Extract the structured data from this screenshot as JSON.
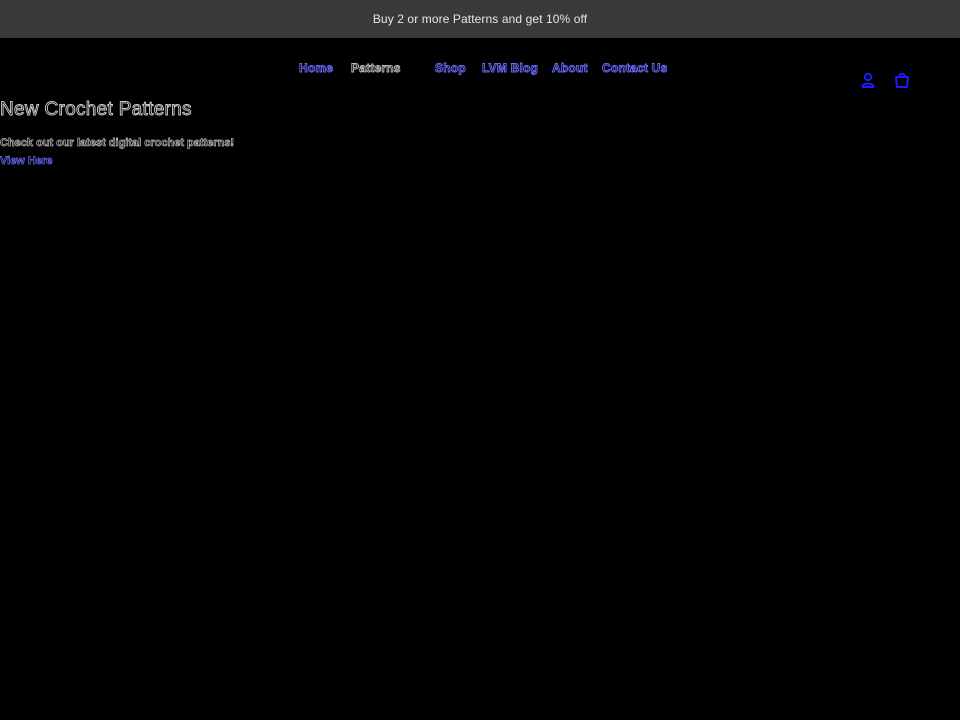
{
  "announcement": {
    "text": "Buy 2 or more Patterns and get 10% off"
  },
  "nav": {
    "items": [
      {
        "label": "Home"
      },
      {
        "label": "Patterns"
      },
      {
        "label": "Shop"
      },
      {
        "label": "LVM Blog"
      },
      {
        "label": "About"
      },
      {
        "label": "Contact Us"
      }
    ]
  },
  "header_icons": {
    "account": "account-icon",
    "cart": "cart-icon",
    "color": "#1a1aff"
  },
  "hero": {
    "title": "New Crochet Patterns",
    "subtitle": "Check out our latest digital crochet patterns!",
    "link_label": "View Here"
  },
  "colors": {
    "background": "#000000",
    "announcement_bg": "#3a3a3a",
    "link": "#6b6bff"
  }
}
